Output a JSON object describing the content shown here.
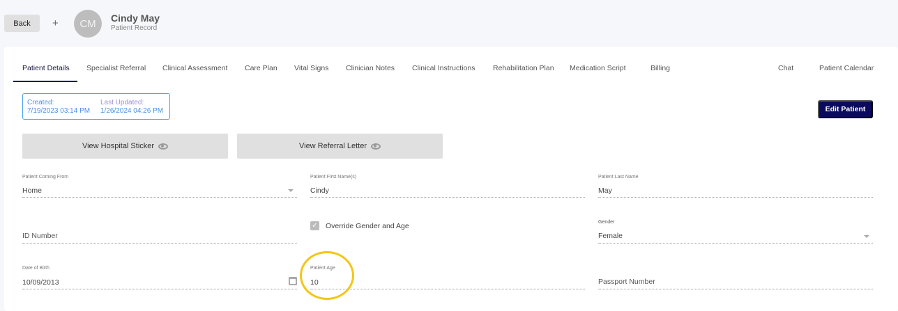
{
  "header": {
    "back": "Back",
    "add": "+",
    "initials": "CM",
    "name": "Cindy May",
    "subtitle": "Patient Record"
  },
  "tabs": [
    "Patient Details",
    "Specialist Referral",
    "Clinical Assessment",
    "Care Plan",
    "Vital Signs",
    "Clinician Notes",
    "Clinical Instructions",
    "Rehabilitation Plan",
    "Medication Script",
    "Billing",
    "Chat",
    "Patient Calendar"
  ],
  "dates": {
    "created_label": "Created:",
    "created": "7/19/2023 03:14 PM",
    "updated_label": "Last Updated:",
    "updated": "1/26/2024 04:26 PM"
  },
  "edit_patient": "Edit Patient",
  "buttons": {
    "sticker": "View Hospital Sticker",
    "referral": "View Referral Letter"
  },
  "fields": {
    "coming_from": {
      "label": "Patient Coming From",
      "value": "Home"
    },
    "first_name": {
      "label": "Patient First Name(s)",
      "value": "Cindy"
    },
    "last_name": {
      "label": "Patient Last Name",
      "value": "May"
    },
    "id_number": {
      "placeholder": "ID Number"
    },
    "override": {
      "label": "Override Gender and Age",
      "checked": true
    },
    "gender": {
      "label": "Gender",
      "value": "Female"
    },
    "dob": {
      "label": "Date of Birth",
      "value": "10/09/2013"
    },
    "age": {
      "label": "Patient Age",
      "value": "10"
    },
    "passport": {
      "placeholder": "Passport Number"
    }
  },
  "colors": {
    "accent": "#0a0a5e",
    "highlight": "#f5c518"
  }
}
